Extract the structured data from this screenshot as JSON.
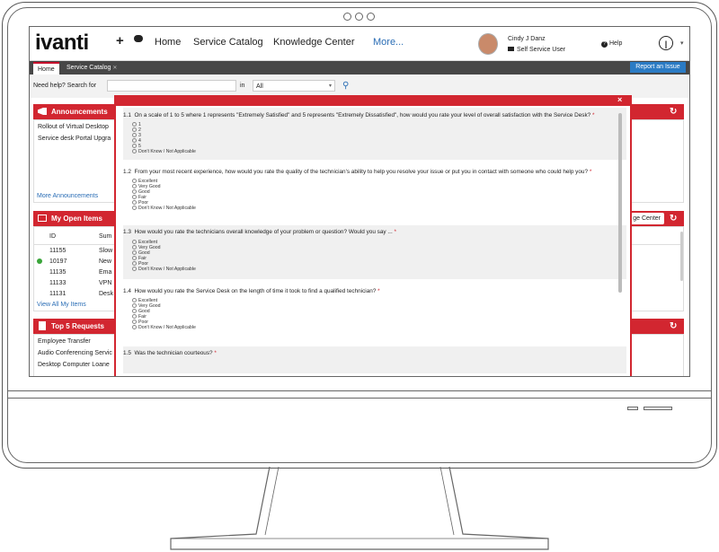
{
  "header": {
    "logo": "ivanti",
    "nav": [
      "Home",
      "Service Catalog",
      "Knowledge Center",
      "More..."
    ],
    "user_name": "Cindy J Danz",
    "user_role": "Self Service User",
    "help": "Help"
  },
  "tabs": [
    {
      "label": "Home"
    },
    {
      "label": "Service Catalog"
    }
  ],
  "report_button": "Report an Issue",
  "search": {
    "label": "Need help? Search for",
    "in_label": "in",
    "scope": "All"
  },
  "announcements": {
    "title": "Announcements",
    "items": [
      "Rollout of Virtual Desktop",
      "Service desk Portal Upgra"
    ],
    "more": "More Announcements"
  },
  "open_items": {
    "title": "My Open Items",
    "columns": [
      "ID",
      "Sum"
    ],
    "rows": [
      {
        "id": "11155",
        "sum": "Slow"
      },
      {
        "id": "10197",
        "sum": "New"
      },
      {
        "id": "11135",
        "sum": "Ema"
      },
      {
        "id": "11133",
        "sum": "VPN"
      },
      {
        "id": "11131",
        "sum": "Desk"
      }
    ],
    "view_all": "View All My Items",
    "side_button": "ge Center"
  },
  "top_requests": {
    "title": "Top 5 Requests",
    "items": [
      "Employee Transfer",
      "Audio Conferencing Servic",
      "Desktop Computer Loane"
    ]
  },
  "survey": {
    "close": "×",
    "questions": [
      {
        "num": "1.1",
        "text": "On a scale of 1 to 5 where 1 represents \"Extremely Satisfied\" and 5 represents \"Extremely Dissatisfied\", how would you rate your level of overall satisfaction with the Service Desk?",
        "star": "*",
        "options": [
          "1",
          "2",
          "3",
          "4",
          "5",
          "Don't Know / Not Applicable"
        ]
      },
      {
        "num": "1.2",
        "text": "From your most recent experience, how would you rate the quality of the technician's ability to help you resolve your issue or put you in contact with someone who could help you?",
        "star": "*",
        "options": [
          "Excellent",
          "Very Good",
          "Good",
          "Fair",
          "Poor",
          "Don't Know / Not Applicable"
        ]
      },
      {
        "num": "1.3",
        "text": "How would you rate the technicians overall knowledge of your problem or question? Would you say ...",
        "star": "*",
        "options": [
          "Excellent",
          "Very Good",
          "Good",
          "Fair",
          "Poor",
          "Don't Know / Not Applicable"
        ]
      },
      {
        "num": "1.4",
        "text": "How would you rate the Service Desk on the length of time it took to find a qualified technician?",
        "star": "*",
        "options": [
          "Excellent",
          "Very Good",
          "Good",
          "Fair",
          "Poor",
          "Don't Know / Not Applicable"
        ]
      },
      {
        "num": "1.5",
        "text": "Was the technician courteous?",
        "star": "*",
        "options": []
      }
    ]
  },
  "colors": {
    "accent_red": "#d22630",
    "tab_bar": "#474747",
    "link_blue": "#2a6db5",
    "button_blue": "#2b7bc4"
  }
}
